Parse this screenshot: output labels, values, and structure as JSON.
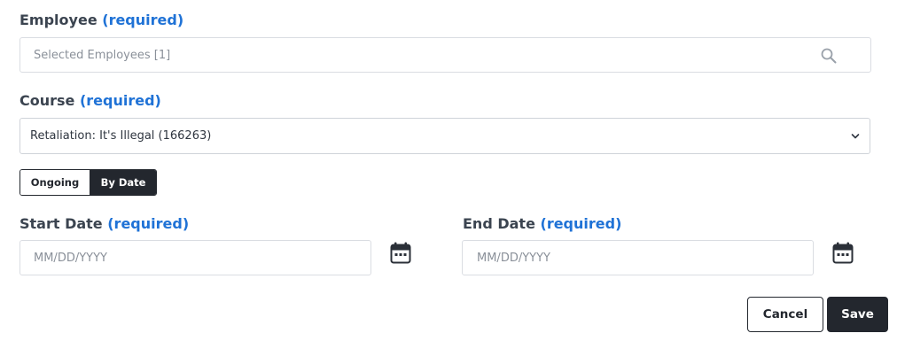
{
  "employee": {
    "label": "Employee",
    "required": "(required)",
    "placeholder": "Selected Employees [1]",
    "icon": "search-icon"
  },
  "course": {
    "label": "Course",
    "required": "(required)",
    "selected": "Retaliation: It's Illegal (166263)",
    "icon": "chevron-down-icon"
  },
  "mode_toggle": {
    "options": [
      "Ongoing",
      "By Date"
    ],
    "selected": "By Date"
  },
  "start_date": {
    "label": "Start Date",
    "required": "(required)",
    "placeholder": "MM/DD/YYYY",
    "icon": "calendar-icon"
  },
  "end_date": {
    "label": "End Date",
    "required": "(required)",
    "placeholder": "MM/DD/YYYY",
    "icon": "calendar-icon"
  },
  "actions": {
    "cancel": "Cancel",
    "save": "Save"
  },
  "colors": {
    "required_accent": "#1f72d6",
    "dark": "#23272e",
    "border": "#dadde2"
  }
}
